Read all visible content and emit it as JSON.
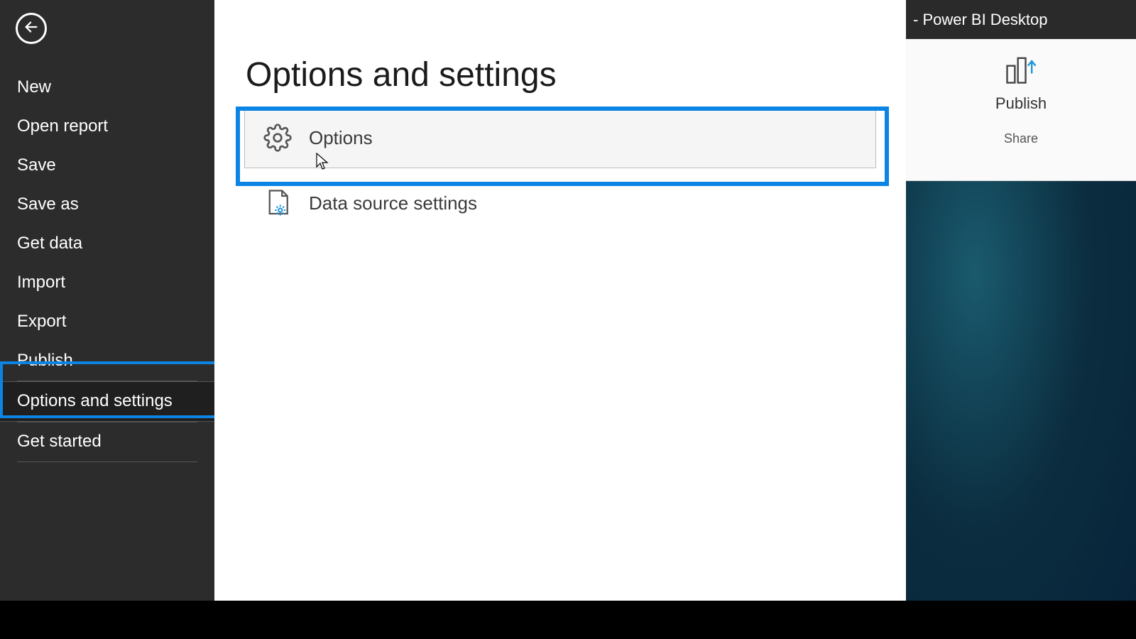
{
  "app_title_suffix": "- Power BI Desktop",
  "sidebar": {
    "items": [
      {
        "label": "New"
      },
      {
        "label": "Open report"
      },
      {
        "label": "Save"
      },
      {
        "label": "Save as"
      },
      {
        "label": "Get data"
      },
      {
        "label": "Import"
      },
      {
        "label": "Export"
      },
      {
        "label": "Publish"
      },
      {
        "label": "Options and settings"
      },
      {
        "label": "Get started"
      }
    ],
    "selected_index": 8
  },
  "main": {
    "title": "Options and settings",
    "items": [
      {
        "label": "Options"
      },
      {
        "label": "Data source settings"
      }
    ],
    "highlighted_index": 0
  },
  "ribbon": {
    "button_label": "Publish",
    "group_label": "Share"
  },
  "colors": {
    "highlight": "#0c84e4",
    "sidebar_bg": "#2c2c2c",
    "accent_icon": "#1f94d6"
  }
}
